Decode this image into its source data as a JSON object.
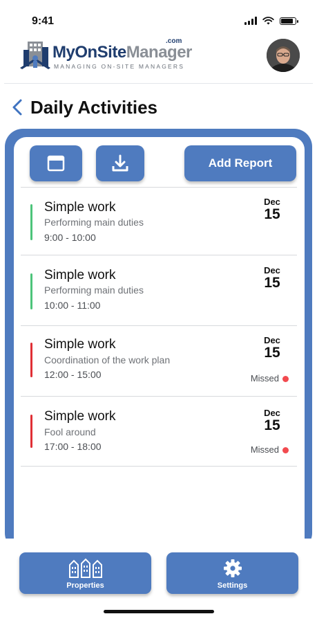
{
  "status_bar": {
    "time": "9:41"
  },
  "brand": {
    "name_part1": "MyOnSite",
    "name_part2": "Manager",
    "domain_suffix": ".com",
    "tagline": "MANAGING ON-SITE MANAGERS"
  },
  "header": {
    "title": "Daily Activities"
  },
  "toolbar": {
    "add_report_label": "Add Report"
  },
  "activities": [
    {
      "title": "Simple work",
      "description": "Performing main duties",
      "time": "9:00 - 10:00",
      "month": "Dec",
      "day": "15",
      "status": "ok",
      "missed_label": ""
    },
    {
      "title": "Simple work",
      "description": "Performing main duties",
      "time": "10:00 - 11:00",
      "month": "Dec",
      "day": "15",
      "status": "ok",
      "missed_label": ""
    },
    {
      "title": "Simple work",
      "description": "Coordination of the work plan",
      "time": "12:00 - 15:00",
      "month": "Dec",
      "day": "15",
      "status": "missed",
      "missed_label": "Missed"
    },
    {
      "title": "Simple work",
      "description": "Fool around",
      "time": "17:00 - 18:00",
      "month": "Dec",
      "day": "15",
      "status": "missed",
      "missed_label": "Missed"
    }
  ],
  "bottom_nav": {
    "properties_label": "Properties",
    "settings_label": "Settings"
  },
  "colors": {
    "accent": "#4f7bbf",
    "ok_status": "#4cc47a",
    "missed_status": "#e02f35",
    "missed_dot": "#f24a4f"
  }
}
